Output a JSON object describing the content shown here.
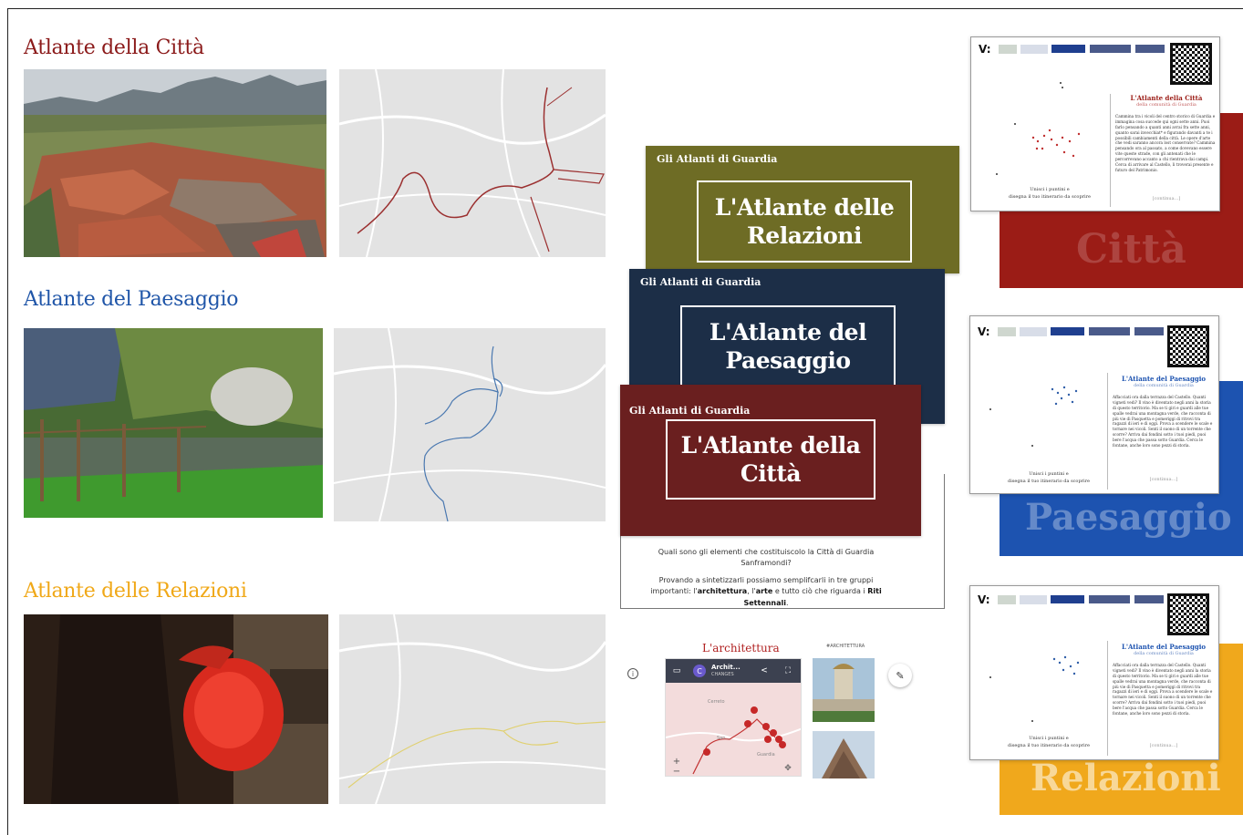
{
  "atlases": {
    "citta": {
      "title": "Atlante della Città",
      "color": "#8b1a1a"
    },
    "paesaggio": {
      "title": "Atlante del Paesaggio",
      "color": "#1f55a8"
    },
    "relazioni": {
      "title": "Atlante delle Relazioni",
      "color": "#f0a818"
    }
  },
  "cards": {
    "kicker": "Gli Atlanti di Guardia",
    "relazioni": {
      "line1": "L'Atlante delle",
      "line2": "Relazioni",
      "color": "#6e6c25"
    },
    "paesaggio": {
      "line1": "L'Atlante del",
      "line2": "Paesaggio",
      "color": "#1c2e47"
    },
    "citta": {
      "line1": "L'Atlante della",
      "line2": "Città",
      "color": "#6a1f1f"
    }
  },
  "story": {
    "question_line1": "Quali sono gli elementi che costituiscolo la Città di Guardia",
    "question_line2": "Sanframondi?",
    "p2_line1": "Provando a sintetizzarli possiamo semplifcarli in tre gruppi",
    "p2_before": "importanti: l'",
    "p2_bold1": "architettura",
    "p2_mid1": ", l'",
    "p2_bold2": "arte",
    "p2_mid2": " e tutto ciò che riguarda i ",
    "p2_bold3": "Riti",
    "p2_bold4": "Settennali",
    "p2_end": ".",
    "section_title": "L'architettura",
    "map_title": "Archit...",
    "map_subtitle": "CHANGES",
    "avatar_letter": "C",
    "map_place1": "Cerreto",
    "map_place2": "San...",
    "map_place3": "Guardia",
    "gallery_label": "#ARCHITETTURA",
    "zoom_in": "+",
    "zoom_out": "−"
  },
  "posters": {
    "logo": "V:",
    "citta": {
      "title": "L'Atlante della Città",
      "subtitle": "della comunità di Guardia",
      "body": "Cammina tra i vicoli del centro storico di Guardia e immagina cosa succede qui ogni sette anni. Puoi farlo pensando a quanti anni avrai fra sette anni, quanto sarai invecchiat* e figurando davanti a te i possibili cambiamenti della città. Le opere d'arte che vedi saranno ancora lost conservate? Cammina pensando ora al passato, a come dovevano essere vite queste strade, con gli antenati che le percorrevano accanto a chi rientrava dai campi. Cerca di arrivare al Castello, li troverai presente e futuro del Patrimonio.",
      "caption1": "Unisci i puntini e",
      "caption2": "disegna il tuo itinerario da scoprire",
      "more": "[continua...]",
      "banner_word": "Città",
      "banner_color": "#9b1c16"
    },
    "paesaggio": {
      "title": "L'Atlante del Paesaggio",
      "subtitle": "della comunità di Guardia",
      "body": "Affacciati ora dalla terrazza del Castello. Quanti vigneti vedi? Il vino è diventato negli anni la storia di questo territorio. Ma se ti giri e guardi alle tue spalle vedrai una montagna verde, che racconta di più vie di Pasquetta e pomeriggi di ritrovi tra ragazzi di ieri e di oggi. Prova a scendere le scale e tornare nei vicoli. Senti il suono di un torrente che scorre? Arriva dai fondini sotto i tuoi piedi, puoi bere l'acqua che passa sotto Guardia. Cerca le fontane, anche loro sono pezzi di storia.",
      "caption1": "Unisci i puntini e",
      "caption2": "disegna il tuo itinerario da scoprire",
      "more": "[continua...]",
      "banner_word": "Paesaggio",
      "banner_color": "#1d53b0"
    },
    "relazioni": {
      "title": "L'Atlante del Paesaggio",
      "subtitle": "della comunità di Guardia",
      "body": "Affacciati ora dalla terrazza del Castello. Quanti vigneti vedi? Il vino è diventato negli anni la storia di questo territorio. Ma se ti giri e guardi alle tue spalle vedrai una montagna verde, che racconta di più vie di Pasquetta e pomeriggi di ritrovi tra ragazzi di ieri e di oggi. Prova a scendere le scale e tornare nei vicoli. Senti il suono di un torrente che scorre? Arriva dai fondini sotto i tuoi piedi, puoi bere l'acqua che passa sotto Guardia. Cerca le fontane, anche loro sono pezzi di storia.",
      "caption1": "Unisci i puntini e",
      "caption2": "disegna il tuo itinerario da scoprire",
      "more": "[continua...]",
      "banner_word": "Relazioni",
      "banner_color": "#f0a81c"
    }
  }
}
